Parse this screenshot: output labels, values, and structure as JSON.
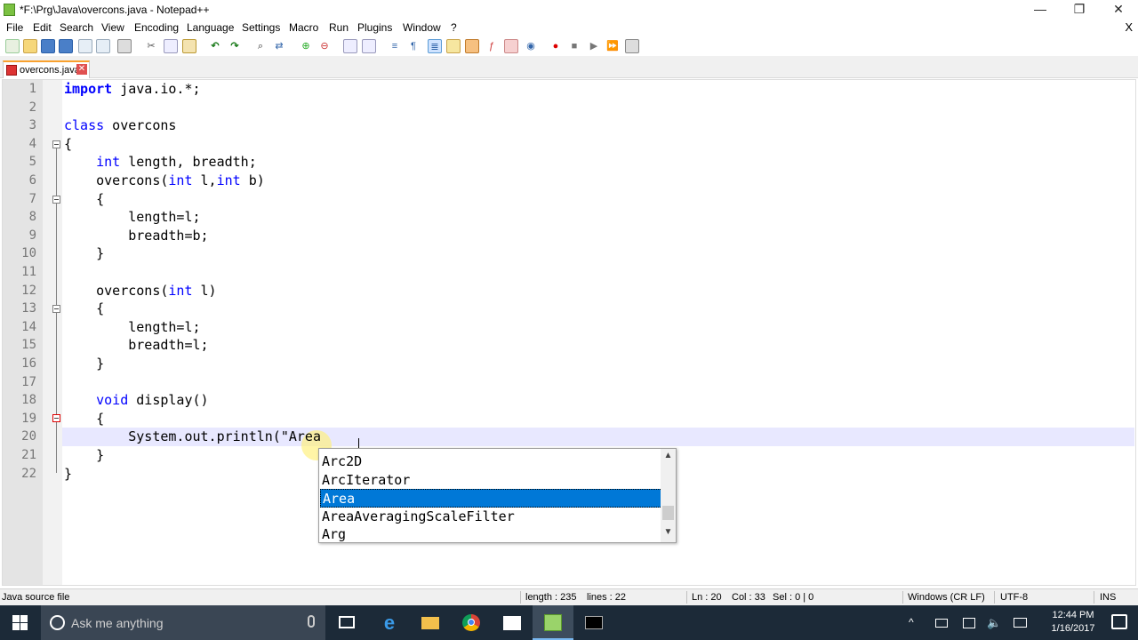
{
  "window": {
    "title": "*F:\\Prg\\Java\\overcons.java - Notepad++",
    "min_glyph": "—",
    "restore_glyph": "❐",
    "close_glyph": "✕"
  },
  "menu": {
    "items": [
      "File",
      "Edit",
      "Search",
      "View",
      "Encoding",
      "Language",
      "Settings",
      "Macro",
      "Run",
      "Plugins",
      "Window",
      "?"
    ],
    "close": "X"
  },
  "tab": {
    "label": "overcons.java",
    "close": "✕"
  },
  "editor": {
    "line_numbers": [
      "1",
      "2",
      "3",
      "4",
      "5",
      "6",
      "7",
      "8",
      "9",
      "10",
      "11",
      "12",
      "13",
      "14",
      "15",
      "16",
      "17",
      "18",
      "19",
      "20",
      "21",
      "22"
    ],
    "lines": [
      {
        "kw": "import",
        "rest": " java.io.*;"
      },
      {
        "kw": "",
        "rest": ""
      },
      {
        "kw": "class",
        "rest": " overcons"
      },
      {
        "kw": "",
        "rest": "{"
      },
      {
        "kw": "int",
        "rest": " length, breadth;",
        "indent": "    "
      },
      {
        "kw": "",
        "rest": "    overcons(",
        "tail_kw": "int",
        "tail": " l,",
        "tail_kw2": "int",
        "tail2": " b)"
      },
      {
        "kw": "",
        "rest": "    {"
      },
      {
        "kw": "",
        "rest": "        length=l;"
      },
      {
        "kw": "",
        "rest": "        breadth=b;"
      },
      {
        "kw": "",
        "rest": "    }"
      },
      {
        "kw": "",
        "rest": ""
      },
      {
        "kw": "",
        "rest": "    overcons(",
        "tail_kw": "int",
        "tail": " l)"
      },
      {
        "kw": "",
        "rest": "    {"
      },
      {
        "kw": "",
        "rest": "        length=l;"
      },
      {
        "kw": "",
        "rest": "        breadth=l;"
      },
      {
        "kw": "",
        "rest": "    }"
      },
      {
        "kw": "",
        "rest": ""
      },
      {
        "kw": "void",
        "rest": " display()",
        "indent": "    "
      },
      {
        "kw": "",
        "rest": "    {"
      },
      {
        "kw": "",
        "rest": "        System.out.println(\"Area"
      },
      {
        "kw": "",
        "rest": "    }"
      },
      {
        "kw": "",
        "rest": "}"
      }
    ]
  },
  "autocomplete": {
    "items": [
      "Arc2D",
      "ArcIterator",
      "Area",
      "AreaAveragingScaleFilter",
      "Arg"
    ],
    "selected_index": 2,
    "up": "▲",
    "down": "▼"
  },
  "status": {
    "file_type": "Java source file",
    "length": "length : 235",
    "lines": "lines : 22",
    "ln": "Ln : 20",
    "col": "Col : 33",
    "sel": "Sel : 0 | 0",
    "eol": "Windows (CR LF)",
    "encoding": "UTF-8",
    "mode": "INS"
  },
  "taskbar": {
    "search_placeholder": "Ask me anything",
    "time": "12:44 PM",
    "date": "1/16/2017",
    "tray_up": "^"
  },
  "colors": {
    "accent": "#0078d7",
    "keyword": "#0000ff",
    "taskbar": "#1c2a38"
  }
}
